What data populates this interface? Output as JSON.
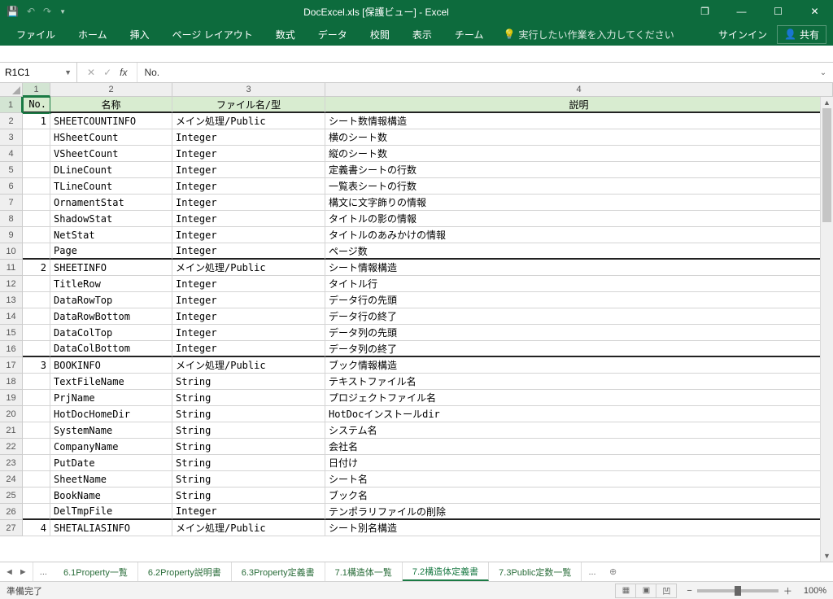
{
  "title": "DocExcel.xls  [保護ビュー] - Excel",
  "qat": {
    "save": "save-icon",
    "undo": "undo-icon",
    "redo": "redo-icon"
  },
  "winbtns": {
    "ribbonopt": "▾",
    "min": "—",
    "max": "☐",
    "close": "✕",
    "restore": "❐"
  },
  "ribbon": {
    "tabs": [
      "ファイル",
      "ホーム",
      "挿入",
      "ページ レイアウト",
      "数式",
      "データ",
      "校閲",
      "表示",
      "チーム"
    ],
    "tellme_icon": "lightbulb-icon",
    "tellme": "実行したい作業を入力してください",
    "signin": "サインイン",
    "share_icon": "person-icon",
    "share": "共有"
  },
  "formulabar": {
    "namebox": "R1C1",
    "fx": "fx",
    "value": "No.",
    "cancel": "✕",
    "enter": "✓"
  },
  "colnums": [
    "1",
    "2",
    "3",
    "4"
  ],
  "headers": [
    "No.",
    "名称",
    "ファイル名/型",
    "説明"
  ],
  "rows": [
    {
      "r": "1",
      "no": "",
      "name": "",
      "type": "",
      "desc": "",
      "hdr": true
    },
    {
      "r": "2",
      "no": "1",
      "name": "SHEETCOUNTINFO",
      "type": "メイン処理/Public",
      "desc": "シート数情報構造",
      "top": true
    },
    {
      "r": "3",
      "no": "",
      "name": "HSheetCount",
      "type": "Integer",
      "desc": "横のシート数"
    },
    {
      "r": "4",
      "no": "",
      "name": "VSheetCount",
      "type": "Integer",
      "desc": "縦のシート数"
    },
    {
      "r": "5",
      "no": "",
      "name": "DLineCount",
      "type": "Integer",
      "desc": "定義書シートの行数"
    },
    {
      "r": "6",
      "no": "",
      "name": "TLineCount",
      "type": "Integer",
      "desc": "一覧表シートの行数"
    },
    {
      "r": "7",
      "no": "",
      "name": "OrnamentStat",
      "type": "Integer",
      "desc": "構文に文字飾りの情報"
    },
    {
      "r": "8",
      "no": "",
      "name": "ShadowStat",
      "type": "Integer",
      "desc": "タイトルの影の情報"
    },
    {
      "r": "9",
      "no": "",
      "name": "NetStat",
      "type": "Integer",
      "desc": "タイトルのあみかけの情報"
    },
    {
      "r": "10",
      "no": "",
      "name": "Page",
      "type": "Integer",
      "desc": "ページ数",
      "sec": true
    },
    {
      "r": "11",
      "no": "2",
      "name": "SHEETINFO",
      "type": "メイン処理/Public",
      "desc": "シート情報構造",
      "top": true
    },
    {
      "r": "12",
      "no": "",
      "name": "TitleRow",
      "type": "Integer",
      "desc": "タイトル行"
    },
    {
      "r": "13",
      "no": "",
      "name": "DataRowTop",
      "type": "Integer",
      "desc": "データ行の先頭"
    },
    {
      "r": "14",
      "no": "",
      "name": "DataRowBottom",
      "type": "Integer",
      "desc": "データ行の終了"
    },
    {
      "r": "15",
      "no": "",
      "name": "DataColTop",
      "type": "Integer",
      "desc": "データ列の先頭"
    },
    {
      "r": "16",
      "no": "",
      "name": "DataColBottom",
      "type": "Integer",
      "desc": "データ列の終了",
      "sec": true
    },
    {
      "r": "17",
      "no": "3",
      "name": "BOOKINFO",
      "type": "メイン処理/Public",
      "desc": "ブック情報構造",
      "top": true
    },
    {
      "r": "18",
      "no": "",
      "name": "TextFileName",
      "type": "String",
      "desc": "テキストファイル名"
    },
    {
      "r": "19",
      "no": "",
      "name": "PrjName",
      "type": "String",
      "desc": "プロジェクトファイル名"
    },
    {
      "r": "20",
      "no": "",
      "name": "HotDocHomeDir",
      "type": "String",
      "desc": "HotDocインストールdir"
    },
    {
      "r": "21",
      "no": "",
      "name": "SystemName",
      "type": "String",
      "desc": "システム名"
    },
    {
      "r": "22",
      "no": "",
      "name": "CompanyName",
      "type": "String",
      "desc": "会社名"
    },
    {
      "r": "23",
      "no": "",
      "name": "PutDate",
      "type": "String",
      "desc": "日付け"
    },
    {
      "r": "24",
      "no": "",
      "name": "SheetName",
      "type": "String",
      "desc": "シート名"
    },
    {
      "r": "25",
      "no": "",
      "name": "BookName",
      "type": "String",
      "desc": "ブック名"
    },
    {
      "r": "26",
      "no": "",
      "name": "DelTmpFile",
      "type": "Integer",
      "desc": "テンポラリファイルの削除",
      "sec": true
    },
    {
      "r": "27",
      "no": "4",
      "name": "SHETALIASINFO",
      "type": "メイン処理/Public",
      "desc": "シート別名構造",
      "top": true
    }
  ],
  "sheettabs": {
    "ellipsis": "...",
    "tabs": [
      {
        "label": "6.1Property一覧",
        "active": false
      },
      {
        "label": "6.2Property説明書",
        "active": false
      },
      {
        "label": "6.3Property定義書",
        "active": false
      },
      {
        "label": "7.1構造体一覧",
        "active": false
      },
      {
        "label": "7.2構造体定義書",
        "active": true
      },
      {
        "label": "7.3Public定数一覧",
        "active": false
      }
    ],
    "add": "⊕"
  },
  "statusbar": {
    "status": "準備完了",
    "zoom": "100%",
    "minus": "−",
    "plus": "＋"
  }
}
